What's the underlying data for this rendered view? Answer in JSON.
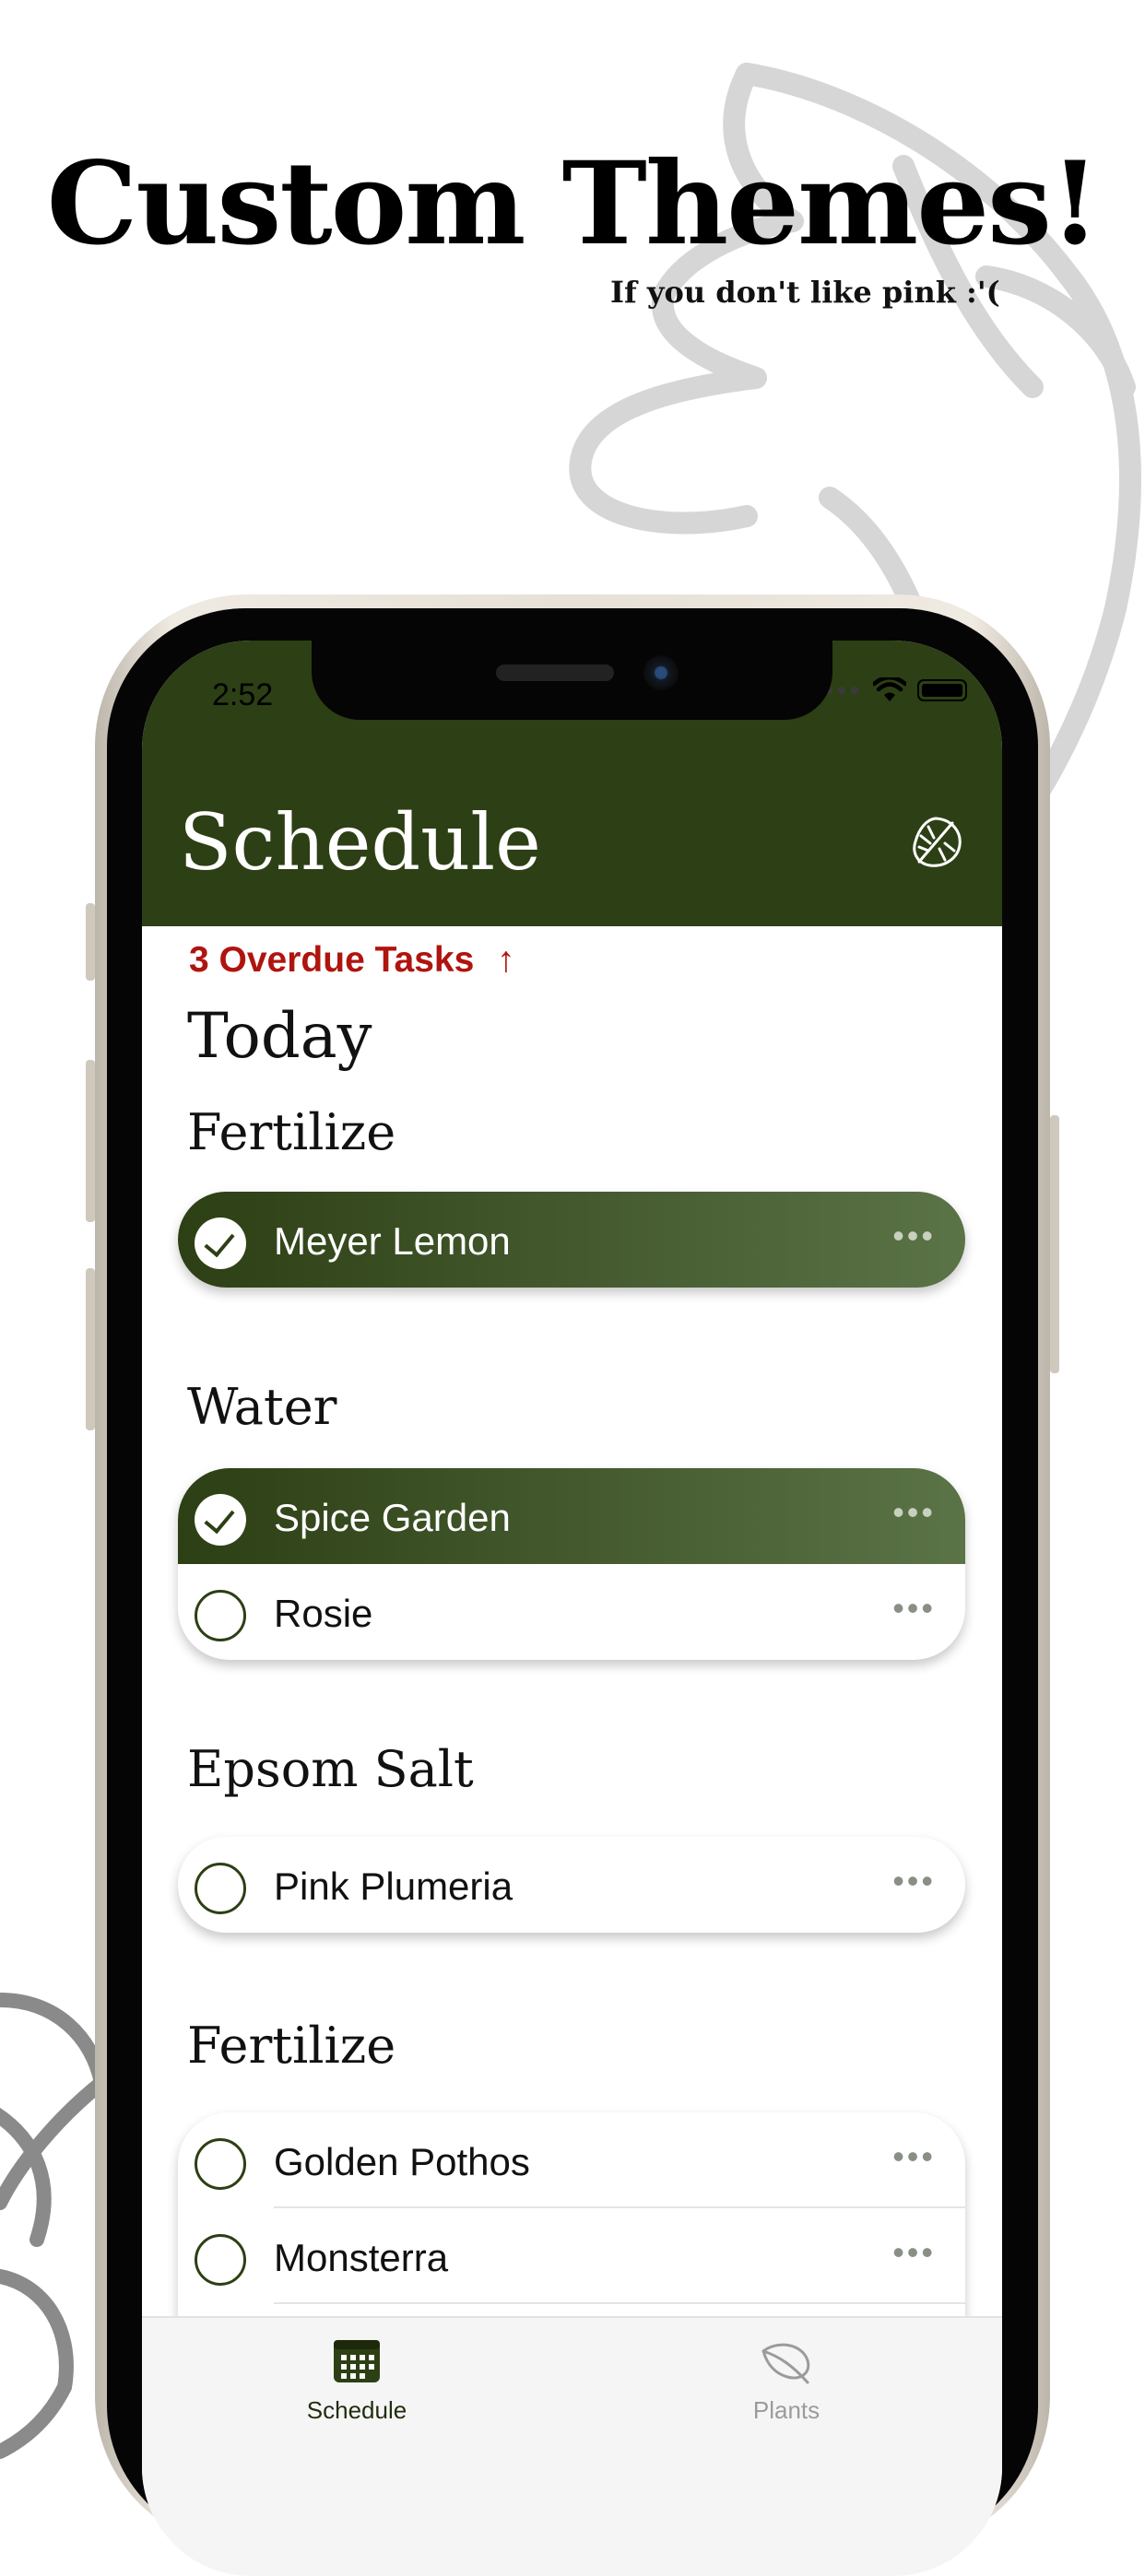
{
  "promo": {
    "headline": "Custom Themes!",
    "subline": "If you don't like pink :'("
  },
  "status_bar": {
    "time": "2:52"
  },
  "header": {
    "title": "Schedule",
    "icon": "monstera-leaf-icon",
    "color": "#2d3f14"
  },
  "overdue": {
    "label": "3 Overdue Tasks",
    "icon": "arrow-up-icon",
    "color": "#b0140f"
  },
  "day_heading": "Today",
  "sections": [
    {
      "title": "Fertilize",
      "tasks": [
        {
          "name": "Meyer Lemon",
          "done": true
        }
      ]
    },
    {
      "title": "Water",
      "tasks": [
        {
          "name": "Spice Garden",
          "done": true
        },
        {
          "name": "Rosie",
          "done": false
        }
      ]
    },
    {
      "title": "Epsom Salt",
      "tasks": [
        {
          "name": "Pink Plumeria",
          "done": false
        }
      ]
    },
    {
      "title": "Fertilize",
      "tasks": [
        {
          "name": "Golden Pothos",
          "done": false
        },
        {
          "name": "Monsterra",
          "done": false
        }
      ]
    }
  ],
  "more_glyph": "•••",
  "tabbar": {
    "tabs": [
      {
        "label": "Schedule",
        "icon": "calendar-icon",
        "selected": true
      },
      {
        "label": "Plants",
        "icon": "leaf-icon",
        "selected": false
      }
    ]
  }
}
